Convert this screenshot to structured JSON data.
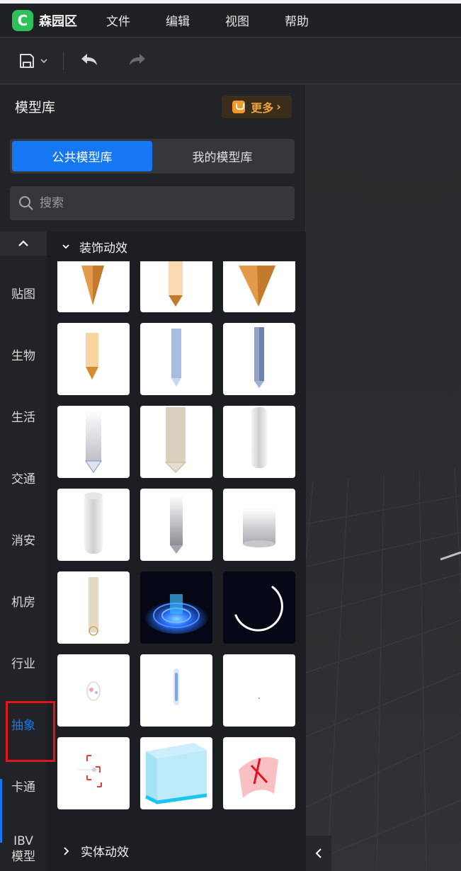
{
  "app": {
    "name": "森园区",
    "logo_letter": "C"
  },
  "menu": {
    "items": [
      "文件",
      "编辑",
      "视图",
      "帮助"
    ]
  },
  "toolbar": {
    "save_icon": "save-icon",
    "undo_icon": "undo-icon",
    "redo_icon": "redo-icon"
  },
  "library": {
    "title": "模型库",
    "more_label": "更多",
    "more_arrow": "›",
    "tabs": [
      {
        "label": "公共模型库",
        "active": true
      },
      {
        "label": "我的模型库",
        "active": false
      }
    ],
    "search_placeholder": "搜索"
  },
  "categories": {
    "items": [
      "贴图",
      "生物",
      "生活",
      "交通",
      "消安",
      "机房",
      "行业",
      "抽象",
      "卡通",
      "IBV\n模型"
    ],
    "active": "抽象"
  },
  "sections": {
    "current": "装饰动效",
    "next": "实体动效"
  },
  "colors": {
    "accent": "#1677f2",
    "highlight_box": "#e0141e",
    "more_text": "#f0a23a"
  }
}
